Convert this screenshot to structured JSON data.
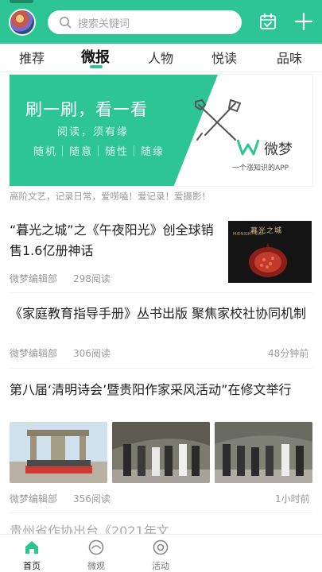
{
  "header": {
    "search_placeholder": "搜索关键词",
    "icons": [
      "avatar",
      "search-icon",
      "calendar-icon",
      "plus-icon"
    ],
    "accent_color": "#2ec594"
  },
  "tabs": [
    {
      "label": "推荐",
      "active": false
    },
    {
      "label": "微报",
      "active": true
    },
    {
      "label": "人物",
      "active": false
    },
    {
      "label": "悦读",
      "active": false
    },
    {
      "label": "品味",
      "active": false
    }
  ],
  "banner": {
    "title": "刷一刷，看一看",
    "line1": "阅读，须有缘",
    "line2": "随机｜随意｜随性｜随缘",
    "logo_text": "微梦",
    "logo_slogan": "一个涨知识的APP"
  },
  "tagline": "高阶文艺，记录日常，爱唠嗑！爱记录！爱摄影！",
  "articles": [
    {
      "title": "“暮光之城”之《午夜阳光》创全球销售1.6亿册神话",
      "author": "微梦编辑部",
      "reads": "298阅读",
      "time": "",
      "book_cover_title": "暮光之城",
      "book_cover_sub": "MIDNIGHT SUN"
    },
    {
      "title": "《家庭教育指导手册》丛书出版 聚焦家校社协同机制",
      "author": "微梦编辑部",
      "reads": "306阅读",
      "time": "48分钟前"
    },
    {
      "title": "第八届‘清明诗会’暨贵阳作家采风活动”在修文举行",
      "author": "微梦编辑部",
      "reads": "356阅读",
      "time": "1小时前"
    },
    {
      "title": "贵州省作协出台《2021年文",
      "author": "",
      "reads": "",
      "time": ""
    }
  ],
  "bottom_nav": [
    {
      "label": "首页",
      "icon": "home-icon",
      "active": true
    },
    {
      "label": "微观",
      "icon": "eye-icon",
      "active": false
    },
    {
      "label": "活动",
      "icon": "activity-icon",
      "active": false
    }
  ]
}
